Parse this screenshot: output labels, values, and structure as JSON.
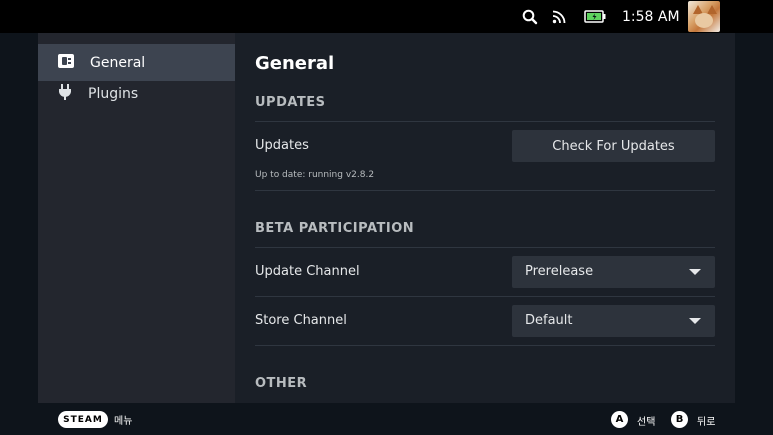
{
  "topbar": {
    "icons": [
      "search-icon",
      "rss-icon",
      "battery-icon"
    ],
    "time": "1:58 AM",
    "battery_color": "#5fd35f"
  },
  "sidebar": {
    "items": [
      {
        "label": "General",
        "icon": "plug-box-icon",
        "active": true
      },
      {
        "label": "Plugins",
        "icon": "plug-icon",
        "active": false
      }
    ]
  },
  "main": {
    "title": "General",
    "sections": {
      "updates": {
        "header": "UPDATES",
        "row_label": "Updates",
        "row_desc": "Up to date: running v2.8.2",
        "button_label": "Check For Updates"
      },
      "beta": {
        "header": "BETA PARTICIPATION",
        "update_channel_label": "Update Channel",
        "update_channel_value": "Prerelease",
        "store_channel_label": "Store Channel",
        "store_channel_value": "Default"
      },
      "other": {
        "header": "OTHER"
      }
    }
  },
  "bottombar": {
    "steam_label": "STEAM",
    "menu_label": "메뉴",
    "a_button": "A",
    "a_label": "선택",
    "b_button": "B",
    "b_label": "뒤로"
  },
  "colors": {
    "background": "#0e141b",
    "sidebar": "#23262e",
    "sidebar_active": "#3d4450",
    "panel": "#1a1f27",
    "control": "#2d333c"
  }
}
